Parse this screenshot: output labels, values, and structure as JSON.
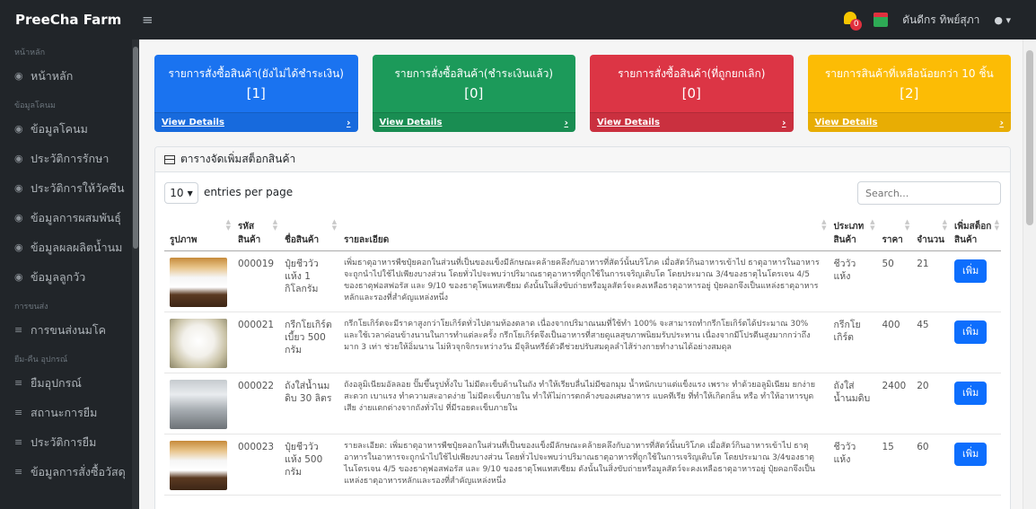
{
  "app": {
    "brand": "PreeCha Farm"
  },
  "topnav": {
    "notification_count": "0",
    "user_name": "ดันดีกร ทิพย์สุภา"
  },
  "sidebar": {
    "sections": [
      {
        "heading": "หน้าหลัก",
        "items": [
          {
            "label": "หน้าหลัก",
            "icon": "dashboard-icon"
          }
        ]
      },
      {
        "heading": "ข้อมูลโคนม",
        "items": [
          {
            "label": "ข้อมูลโคนม",
            "icon": "circle-icon"
          },
          {
            "label": "ประวัติการรักษา",
            "icon": "circle-icon"
          },
          {
            "label": "ประวัติการให้วัคซีน",
            "icon": "circle-icon"
          },
          {
            "label": "ข้อมูลการผสมพันธุ์",
            "icon": "circle-icon"
          },
          {
            "label": "ข้อมูลผลผลิตน้ำนม",
            "icon": "circle-icon"
          },
          {
            "label": "ข้อมูลลูกวัว",
            "icon": "circle-icon"
          }
        ]
      },
      {
        "heading": "การขนส่ง",
        "items": [
          {
            "label": "การขนส่งนมโค",
            "icon": "list-icon"
          }
        ]
      },
      {
        "heading": "ยืม-คืน อุปกรณ์",
        "items": [
          {
            "label": "ยืมอุปกรณ์",
            "icon": "list-icon"
          },
          {
            "label": "สถานะการยืม",
            "icon": "list-icon"
          },
          {
            "label": "ประวัติการยืม",
            "icon": "list-icon"
          },
          {
            "label": "ข้อมูลการสั่งซื้อวัสดุ",
            "icon": "list-icon"
          }
        ]
      }
    ]
  },
  "cards": [
    {
      "title": "รายการสั่งซื้อสินค้า(ยังไม่ได้ชำระเงิน)",
      "value": "[1]",
      "link": "View Details",
      "color": "#1a73f0"
    },
    {
      "title": "รายการสั่งซื้อสินค้า(ชำระเงินแล้ว)",
      "value": "[0]",
      "link": "View Details",
      "color": "#1c9a5a"
    },
    {
      "title": "รายการสั่งซื้อสินค้า(ที่ถูกยกเลิก)",
      "value": "[0]",
      "link": "View Details",
      "color": "#dc3545"
    },
    {
      "title": "รายการสินค้าที่เหลือน้อยกว่า 10 ชิ้น",
      "value": "[2]",
      "link": "View Details",
      "color": "#fcbc05"
    }
  ],
  "panel": {
    "title": "ตารางจัดเพิ่มสต็อกสินค้า"
  },
  "controls": {
    "entries_value": "10",
    "entries_label": "entries per page",
    "search_placeholder": "Search..."
  },
  "table": {
    "headers": [
      "รูปภาพ",
      "รหัสสินค้า",
      "ชื่อสินค้า",
      "รายละเอียด",
      "ประเภทสินค้า",
      "ราคา",
      "จำนวน",
      "เพิ่มสต็อกสินค้า"
    ],
    "add_label": "เพิ่ม",
    "rows": [
      {
        "img": "fertilizer-bag-image",
        "code": "000019",
        "name": "ปุ๋ยชีววัวแห้ง 1 กิโลกรัม",
        "detail": "เพิ่มธาตุอาหารพืชปุ๋ยคอกในส่วนที่เป็นของแข็งมีลักษณะคล้ายคลึงกับอาหารที่สัตว์นั้นบริโภค เมื่อสัตว์กินอาหารเข้าไป ธาตุอาหารในอาหารจะถูกนำไปใช้ไปเพียงบางส่วน โดยทั่วไปจะพบว่าปริมาณธาตุอาหารที่ถูกใช้ในการเจริญเติบโต โดยประมาณ 3/4ของธาตุไนโตรเจน 4/5 ของธาตุฟอสฟอรัส และ 9/10 ของธาตุโพแทสเซียม ดังนั้นในสิ่งขับถ่ายหรือมูลสัตว์จะคงเหลือธาตุอาหารอยู่ ปุ๋ยคอกจึงเป็นแหล่งธาตุอาหารหลักและรองที่สำคัญแหล่งหนึ่ง",
        "type": "ชีววัวแห้ง",
        "price": "50",
        "qty": "21"
      },
      {
        "img": "milk-powder-image",
        "code": "000021",
        "name": "กรีกโยเกิร์ต เบี้ยว 500 กรัม",
        "detail": "กรีกโยเกิร์ตจะมีราคาสูงกว่าโยเกิร์ตทั่วไปตามท้องตลาด เนื่องจากปริมาณนมที่ใช้ทำ 100% จะสามารถทำกรีกโยเกิร์ตได้ประมาณ 30% และใช้เวลาค่อนข้างนานในการทำแต่ละครั้ง กรีกโยเกิร์ตจึงเป็นอาหารที่สายดูแลสุขภาพนิยมรับประทาน เนื่องจากมีโปรตีนสูงมากกว่าถึงมาก 3 เท่า ช่วยให้อิ่มนาน ไม่หิวจุกจิกระหว่างวัน มีจุลินทรีย์ตัวดีช่วยปรับสมดุลลำไส้ร่างกายทำงานได้อย่างสมดุล",
        "type": "กรีกโยเกิร์ต",
        "price": "400",
        "qty": "45"
      },
      {
        "img": "milk-can-image",
        "code": "000022",
        "name": "ถังใส่น้ำนมดิบ 30 ลิตร",
        "detail": "ถังอลูมิเนียมอัลลอย ปั๊มขึ้นรูปทั้งใบ ไม่มีตะเข็บด้านในถัง ทำให้เรียบลื่นไม่มีซอกมุม น้ำหนักเบาแต่แข็งแรง เพราะ ทำด้วยอลูมิเนียม ยกง่าย สะดวก เบาแรง ทำความสะอาดง่าย ไม่มีตะเข็บภายใน ทำให้ไม่การตกค้างของเศษอาหาร แบคทีเรีย ที่ทำให้เกิดกลิ่น หรือ ทำให้อาหารบูดเสีย ง่ายแตกต่างจากถังทั่วไป ที่มีรอยตะเข็บภายใน",
        "type": "ถังใส่น้ำนมดิบ",
        "price": "2400",
        "qty": "20"
      },
      {
        "img": "fertilizer-bag-image",
        "code": "000023",
        "name": "ปุ๋ยชีววัวแห้ง 500 กรัม",
        "detail": "รายละเอียด: เพิ่มธาตุอาหารพืชปุ๋ยคอกในส่วนที่เป็นของแข็งมีลักษณะคล้ายคลึงกับอาหารที่สัตว์นั้นบริโภค เมื่อสัตว์กินอาหารเข้าไป ธาตุอาหารในอาหารจะถูกนำไปใช้ไปเพียงบางส่วน โดยทั่วไปจะพบว่าปริมาณธาตุอาหารที่ถูกใช้ในการเจริญเติบโต โดยประมาณ 3/4ของธาตุไนโตรเจน 4/5 ของธาตุฟอสฟอรัส และ 9/10 ของธาตุโพแทสเซียม ดังนั้นในสิ่งขับถ่ายหรือมูลสัตว์จะคงเหลือธาตุอาหารอยู่ ปุ๋ยคอกจึงเป็นแหล่งธาตุอาหารหลักและรองที่สำคัญแหล่งหนึ่ง",
        "type": "ชีววัวแห้ง",
        "price": "15",
        "qty": "60"
      }
    ]
  }
}
